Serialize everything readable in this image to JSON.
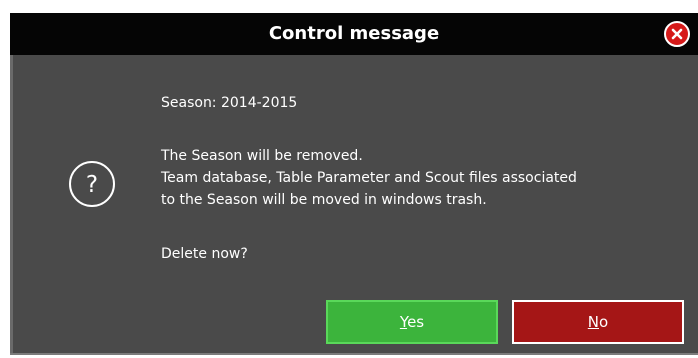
{
  "dialog": {
    "title": "Control message",
    "close_icon": "close-circle-icon",
    "question_icon": "question-circle-icon",
    "season_line": "Season: 2014-2015",
    "message_line1": "The Season will be removed.",
    "message_line2": "Team database, Table Parameter and Scout files associated",
    "message_line3": "to the Season will be moved in windows trash.",
    "prompt": "Delete now?",
    "yes_mnemonic": "Y",
    "yes_rest": "es",
    "no_mnemonic": "N",
    "no_rest": "o"
  },
  "colors": {
    "titlebar": "#050505",
    "body": "#4a4a4a",
    "yes_button": "#3cb43c",
    "no_button": "#a51616",
    "close_button": "#d61a1a"
  }
}
